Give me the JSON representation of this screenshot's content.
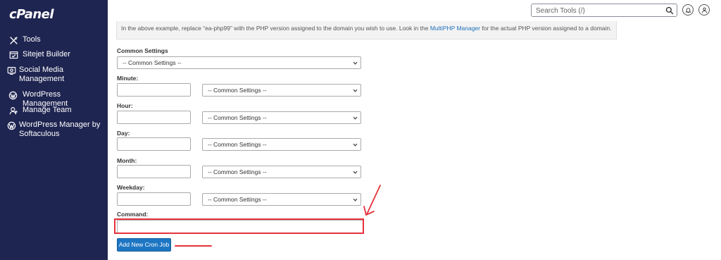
{
  "brand": {
    "logo_text": "cPanel"
  },
  "sidebar": {
    "items": [
      {
        "label": "Tools",
        "icon": "tools-icon"
      },
      {
        "label": "Sitejet Builder",
        "icon": "sitejet-icon"
      },
      {
        "label": "Social Media Management",
        "icon": "social-media-icon"
      },
      {
        "label": "WordPress Management",
        "icon": "wordpress-icon"
      },
      {
        "label": "Manage Team",
        "icon": "team-icon"
      },
      {
        "label": "WordPress Manager by Softaculous",
        "icon": "wordpress-icon"
      }
    ]
  },
  "header": {
    "search_placeholder": "Search Tools (/)",
    "search_icon": "search-icon",
    "notifications_icon": "bell-icon",
    "user_icon": "user-icon"
  },
  "note": {
    "text_before": "In the above example, replace “ea-php99” with the PHP version assigned to the domain you wish to use. Look in the ",
    "link_text": "MultiPHP Manager",
    "text_after": " for the actual PHP version assigned to a domain."
  },
  "form": {
    "common_settings_label": "Common Settings",
    "common_settings_value": "-- Common Settings --",
    "minute_label": "Minute:",
    "hour_label": "Hour:",
    "day_label": "Day:",
    "month_label": "Month:",
    "weekday_label": "Weekday:",
    "field_select_value": "-- Common Settings --",
    "command_label": "Command:",
    "submit_label": "Add New Cron Job"
  },
  "colors": {
    "sidebar_bg": "#1f2551",
    "primary_button": "#1d76c3",
    "link": "#1f6fb8",
    "annotation": "#e6323b"
  }
}
